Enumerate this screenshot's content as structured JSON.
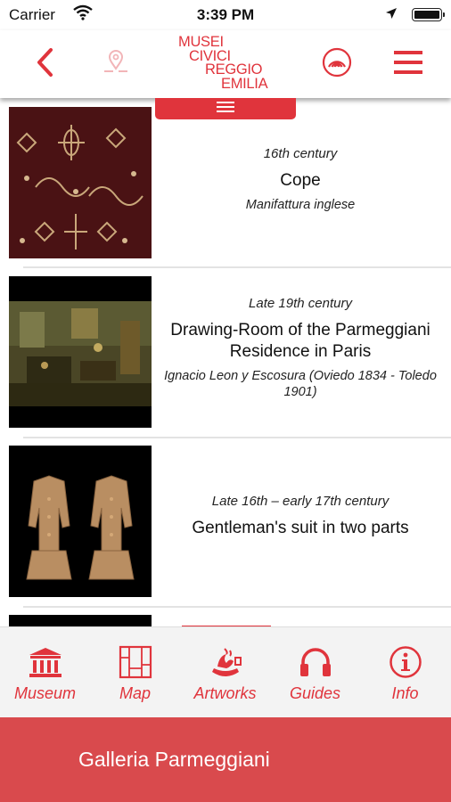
{
  "status_bar": {
    "carrier": "Carrier",
    "time": "3:39 PM"
  },
  "header": {
    "logo_lines": [
      "MUSEI",
      "CIVICI",
      "REGGIO",
      "EMILIA"
    ],
    "icons": [
      "back-chevron-icon",
      "map-pin-icon",
      "audio-signal-icon",
      "hamburger-menu-icon"
    ]
  },
  "items": [
    {
      "era": "16th century",
      "title": "Cope",
      "author": "Manifattura inglese"
    },
    {
      "era": "Late 19th century",
      "title": "Drawing-Room of the Parmeggiani Residence in Paris",
      "author": "Ignacio Leon y Escosura (Oviedo 1834 - Toledo 1901)"
    },
    {
      "era": "Late 16th – early 17th century",
      "title": "Gentleman's suit in two parts",
      "author": ""
    }
  ],
  "tabs": [
    {
      "label": "Museum",
      "icon": "museum-building-icon"
    },
    {
      "label": "Map",
      "icon": "map-icon"
    },
    {
      "label": "Artworks",
      "icon": "artworks-icon"
    },
    {
      "label": "Guides",
      "icon": "headphones-icon"
    },
    {
      "label": "Info",
      "icon": "info-icon"
    }
  ],
  "footer": {
    "label": "Galleria Parmeggiani"
  },
  "colors": {
    "accent": "#e0343c",
    "footer": "#d94a4d",
    "tabbar_bg": "#f3f3f3"
  }
}
